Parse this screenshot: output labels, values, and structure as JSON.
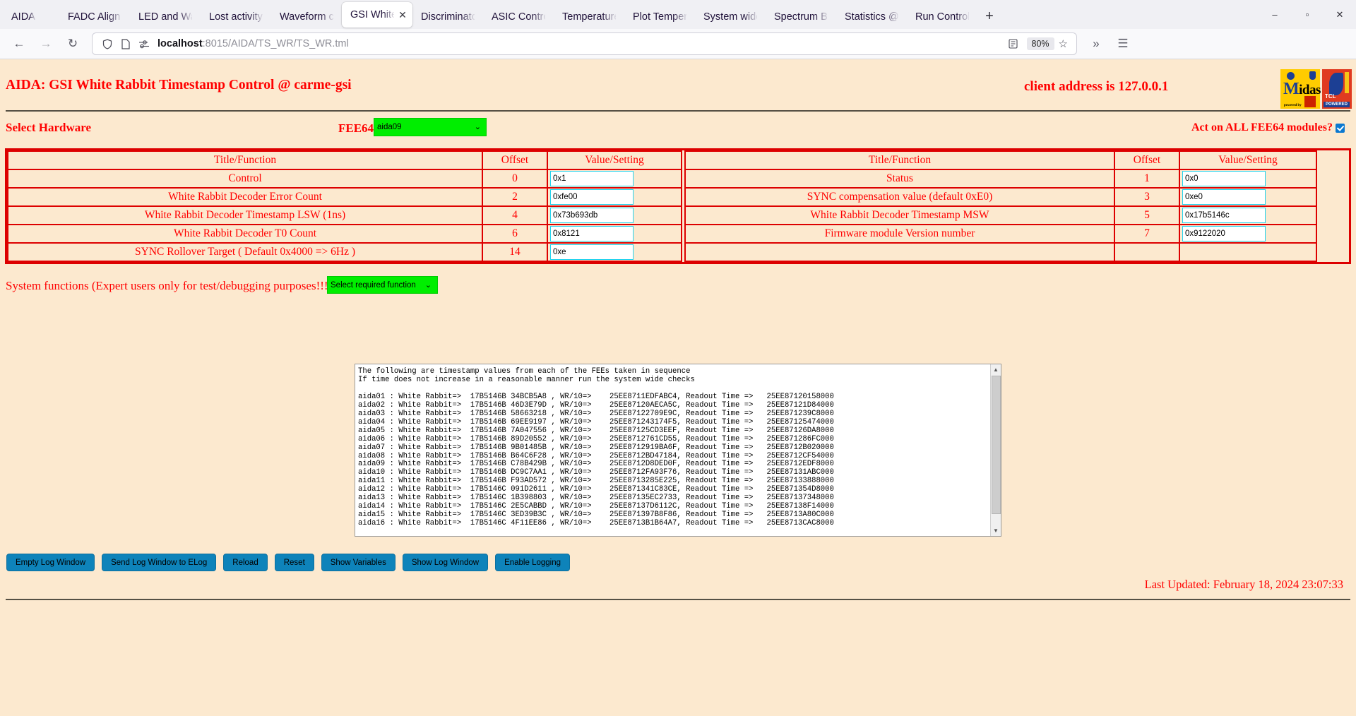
{
  "browser": {
    "tabs": [
      {
        "label": "AIDA",
        "active": false
      },
      {
        "label": "FADC Align & C",
        "active": false
      },
      {
        "label": "LED and Wavef",
        "active": false
      },
      {
        "label": "Lost activity mo",
        "active": false
      },
      {
        "label": "Waveform capt",
        "active": false
      },
      {
        "label": "GSI White Rab",
        "active": true
      },
      {
        "label": "Discriminator co",
        "active": false
      },
      {
        "label": "ASIC Control @",
        "active": false
      },
      {
        "label": "Temperature an",
        "active": false
      },
      {
        "label": "Plot Temperatu",
        "active": false
      },
      {
        "label": "System wide Ch",
        "active": false
      },
      {
        "label": "Spectrum Brow",
        "active": false
      },
      {
        "label": "Statistics @ car",
        "active": false
      },
      {
        "label": "Run Control @ c",
        "active": false
      }
    ],
    "new_tab_label": "+",
    "close_tab_label": "✕",
    "window_minimize": "–",
    "window_maximize": "▫",
    "window_close": "✕",
    "nav": {
      "back": "←",
      "forward": "→",
      "reload": "↻"
    },
    "url_host": "localhost",
    "url_rest": ":8015/AIDA/TS_WR/TS_WR.tml",
    "zoom_level": "80%",
    "reader_icon": "reader-mode-icon",
    "bookmark_icon": "☆",
    "overflow": "»",
    "menu": "☰"
  },
  "header": {
    "title": "AIDA: GSI White Rabbit Timestamp Control @ carme-gsi",
    "client_address": "client address is 127.0.0.1",
    "logo_midas_main": "idas",
    "logo_midas_big": "M",
    "logo_midas_sub": "powered by",
    "logo_tcl_name": "TCL",
    "logo_tcl_powered": "POWERED"
  },
  "controls": {
    "select_hardware_label": "Select Hardware",
    "fee_label": "FEE64",
    "fee_value": "aida09",
    "act_on_all_label": "Act on ALL FEE64 modules?",
    "act_on_all_checked": true,
    "caret": "⌄"
  },
  "table": {
    "headers": {
      "title": "Title/Function",
      "offset": "Offset",
      "value": "Value/Setting"
    },
    "left_rows": [
      {
        "title": "Control",
        "offset": "0",
        "value": "0x1"
      },
      {
        "title": "White Rabbit Decoder Error Count",
        "offset": "2",
        "value": "0xfe00"
      },
      {
        "title": "White Rabbit Decoder Timestamp LSW (1ns)",
        "offset": "4",
        "value": "0x73b693db"
      },
      {
        "title": "White Rabbit Decoder T0 Count",
        "offset": "6",
        "value": "0x8121"
      },
      {
        "title": "SYNC Rollover Target ( Default 0x4000 => 6Hz )",
        "offset": "14",
        "value": "0xe"
      }
    ],
    "right_rows": [
      {
        "title": "Status",
        "offset": "1",
        "value": "0x0"
      },
      {
        "title": "SYNC compensation value (default 0xE0)",
        "offset": "3",
        "value": "0xe0"
      },
      {
        "title": "White Rabbit Decoder Timestamp MSW",
        "offset": "5",
        "value": "0x17b5146c"
      },
      {
        "title": "Firmware module Version number",
        "offset": "7",
        "value": "0x9122020"
      },
      {
        "title": "",
        "offset": "",
        "value": ""
      }
    ]
  },
  "system_functions": {
    "label": "System functions (Expert users only for test/debugging purposes!!!)",
    "select_value": "Select required function",
    "caret": "⌄"
  },
  "log": {
    "content": "The following are timestamp values from each of the FEEs taken in sequence\nIf time does not increase in a reasonable manner run the system wide checks\n\naida01 : White Rabbit=>  17B5146B 34BCB5A8 , WR/10=>    25EE8711EDFABC4, Readout Time =>   25EE87120158000\naida02 : White Rabbit=>  17B5146B 46D3E79D , WR/10=>    25EE87120AECA5C, Readout Time =>   25EE87121D84000\naida03 : White Rabbit=>  17B5146B 58663218 , WR/10=>    25EE87122709E9C, Readout Time =>   25EE871239C8000\naida04 : White Rabbit=>  17B5146B 69EE9197 , WR/10=>    25EE871243174F5, Readout Time =>   25EE87125474000\naida05 : White Rabbit=>  17B5146B 7A047556 , WR/10=>    25EE87125CD3EEF, Readout Time =>   25EE87126DA8000\naida06 : White Rabbit=>  17B5146B 89D20552 , WR/10=>    25EE8712761CD55, Readout Time =>   25EE871286FC000\naida07 : White Rabbit=>  17B5146B 9B01485B , WR/10=>    25EE8712919BA6F, Readout Time =>   25EE8712B020000\naida08 : White Rabbit=>  17B5146B B64C6F28 , WR/10=>    25EE8712BD47184, Readout Time =>   25EE8712CF54000\naida09 : White Rabbit=>  17B5146B C78B429B , WR/10=>    25EE8712D8DED0F, Readout Time =>   25EE8712EDF8000\naida10 : White Rabbit=>  17B5146B DC9C7AA1 , WR/10=>    25EE8712FA93F76, Readout Time =>   25EE87131ABC000\naida11 : White Rabbit=>  17B5146B F93AD572 , WR/10=>    25EE8713285E225, Readout Time =>   25EE87133888000\naida12 : White Rabbit=>  17B5146C 091D2611 , WR/10=>    25EE871341C83CE, Readout Time =>   25EE871354D8000\naida13 : White Rabbit=>  17B5146C 1B398803 , WR/10=>    25EE87135EC2733, Readout Time =>   25EE87137348000\naida14 : White Rabbit=>  17B5146C 2E5CABBD , WR/10=>    25EE87137D6112C, Readout Time =>   25EE87138F14000\naida15 : White Rabbit=>  17B5146C 3ED39B3C , WR/10=>    25EE871397B8F86, Readout Time =>   25EE8713A80C000\naida16 : White Rabbit=>  17B5146C 4F11EE86 , WR/10=>    25EE8713B1B64A7, Readout Time =>   25EE8713CAC8000",
    "scroll_up": "▲",
    "scroll_down": "▼"
  },
  "buttons": [
    {
      "label": "Empty Log Window"
    },
    {
      "label": "Send Log Window to ELog"
    },
    {
      "label": "Reload"
    },
    {
      "label": "Reset"
    },
    {
      "label": "Show Variables"
    },
    {
      "label": "Show Log Window"
    },
    {
      "label": "Enable Logging"
    }
  ],
  "footer": {
    "last_updated": "Last Updated: February 18, 2024 23:07:33"
  },
  "colors": {
    "page_bg": "#fce9cf",
    "accent_red": "#ff0000",
    "table_border": "#dd0000",
    "select_green": "#00ee00",
    "button_blue": "#0e83ba",
    "input_border": "#22d3ee"
  }
}
